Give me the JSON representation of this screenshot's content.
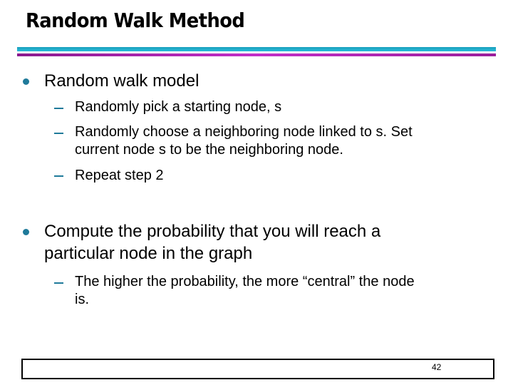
{
  "slide": {
    "title": "Random Walk Method",
    "page_number": "42",
    "colors": {
      "accent_teal": "#1f7a9a",
      "rule_cyan": "#27bcd9",
      "rule_magenta": "#c22ec8"
    },
    "bullets": [
      {
        "lines": [
          "Random walk model"
        ],
        "subitems": [
          {
            "lines": [
              "Randomly pick a starting node, s"
            ]
          },
          {
            "lines": [
              "Randomly choose a neighboring node linked to s. Set",
              "current node s to be the neighboring node."
            ]
          },
          {
            "lines": [
              "Repeat step 2"
            ]
          }
        ]
      },
      {
        "lines": [
          "Compute the probability that you will reach a",
          "particular node in the graph"
        ],
        "subitems": [
          {
            "lines": [
              "The higher the probability, the more “central” the node",
              "is."
            ]
          }
        ]
      }
    ]
  }
}
